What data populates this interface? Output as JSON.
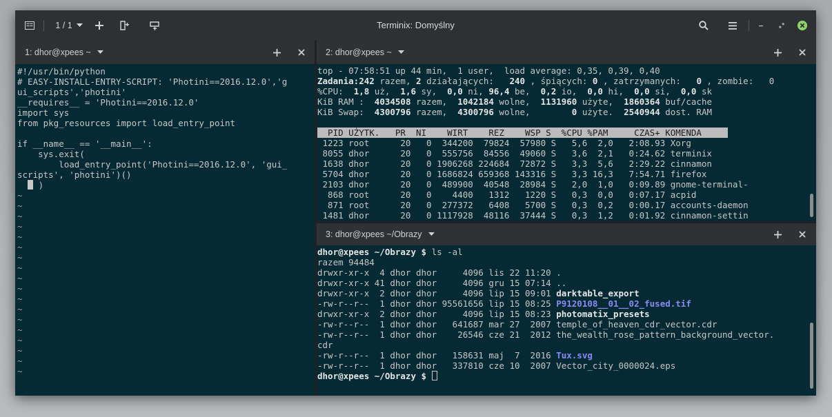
{
  "window": {
    "title": "Terminix: Domyślny",
    "session_counter": "1 / 1"
  },
  "colors": {
    "terminal_bg": "#052a33",
    "header_bg": "#2f3235",
    "close_green": "#8fd46b",
    "link_blue": "#8a8cf5"
  },
  "panes": {
    "left": {
      "label": "1: dhor@xpees ~",
      "lines": [
        "#!/usr/bin/python",
        "# EASY-INSTALL-ENTRY-SCRIPT: 'Photini==2016.12.0','g",
        "ui_scripts','photini'",
        "__requires__ = 'Photini==2016.12.0'",
        "import sys",
        "from pkg_resources import load_entry_point",
        "",
        "if __name__ == '__main__':",
        "    sys.exit(",
        "        load_entry_point('Photini==2016.12.0', 'gui_",
        "scripts', 'photini')()",
        "    )"
      ],
      "tilde": "~",
      "tilde_count": 18
    },
    "top_right": {
      "label": "2: dhor@xpees ~",
      "summary": [
        "top - 07:58:51 up 44 min,  1 user,  load average: 0,35, 0,39, 0,40"
      ],
      "tasks_label": "Zadania:",
      "tasks": [
        {
          "v": "242",
          "t": " razem, "
        },
        {
          "v": "2",
          "t": " działających:   "
        },
        {
          "v": "240",
          "t": " , śpiących: "
        },
        {
          "v": "0",
          "t": " , zatrzymanych:   "
        },
        {
          "v": "0",
          "t": " , zombie:   0"
        }
      ],
      "cpu_line": "%CPU:  1,8 uż,  1,6 sy,  0,0 ni, 96,4 be,  0,2 io,  0,0 hi,  0,0 si,  0,0 sk",
      "ram_line": "KiB RAM :  4034508 razem,  1042184 wolne,  1131960 użyte,  1860364 buf/cache",
      "swap_line": "KiB Swap:  4300796 razem,  4300796 wolne,        0 użyte.  2540944 dost. RAM",
      "table_header": "  PID UŻYTK.   PR  NI    WIRT    REZ    WSP S  %CPU %PAM     CZAS+ KOMENDA     ",
      "processes": [
        " 1223 root      20   0  344200  79824  57980 S   5,6  2,0   2:08.93 Xorg",
        " 8055 dhor      20   0  555756  84556  49060 S   3,6  2,1   0:24.62 terminix",
        " 1638 dhor      20   0 1906268 224684  72872 S   3,3  5,6   2:29.22 cinnamon",
        " 5704 dhor      20   0 1686824 659368 143316 S   3,3 16,3   7:54.71 firefox",
        " 2103 dhor      20   0  489900  40548  28984 S   2,0  1,0   0:09.89 gnome-terminal-",
        "  868 root      20   0    4400   1312   1220 S   0,3  0,0   0:07.17 acpid",
        "  871 root      20   0  277372   6408   5700 S   0,3  0,2   0:00.17 accounts-daemon",
        " 1481 dhor      20   0 1117928  48116  37444 S   0,3  1,2   0:01.92 cinnamon-settin"
      ]
    },
    "bottom_right": {
      "label": "3: dhor@xpees ~/Obrazy",
      "prompt": "dhor@xpees ~/Obrazy $",
      "command": " ls -al",
      "total": "razem 94484",
      "entries": [
        {
          "meta": "drwxr-xr-x  4 dhor dhor     4096 lis 22 11:20 ",
          "name": ".",
          "kind": "plain"
        },
        {
          "meta": "drwxr-xr-x 41 dhor dhor     4096 gru 15 07:14 ",
          "name": "..",
          "kind": "plain"
        },
        {
          "meta": "drwxr-xr-x  2 dhor dhor     4096 lip 15 09:01 ",
          "name": "darktable_export",
          "kind": "dir"
        },
        {
          "meta": "-rw-r--r--  1 dhor dhor 95561656 lip 15 08:25 ",
          "name": "P9120108__01__02_fused.tif",
          "kind": "image"
        },
        {
          "meta": "drwxr-xr-x  2 dhor dhor     4096 lip 15 08:23 ",
          "name": "photomatix_presets",
          "kind": "dir"
        },
        {
          "meta": "-rw-r--r--  1 dhor dhor   641687 mar 27  2007 ",
          "name": "temple_of_heaven_cdr_vector.cdr",
          "kind": "plain"
        },
        {
          "meta": "-rw-r--r--  1 dhor dhor    26546 cze 21  2012 ",
          "name": "the_wealth_rose_pattern_background_vector.",
          "kind": "plain"
        },
        {
          "meta": "",
          "name": "cdr",
          "kind": "plain"
        },
        {
          "meta": "-rw-r--r--  1 dhor dhor   158631 maj  7  2016 ",
          "name": "Tux.svg",
          "kind": "image"
        },
        {
          "meta": "-rw-r--r--  1 dhor dhor   337810 cze 10  2007 ",
          "name": "Vector_city_0000024.eps",
          "kind": "plain"
        }
      ]
    }
  }
}
